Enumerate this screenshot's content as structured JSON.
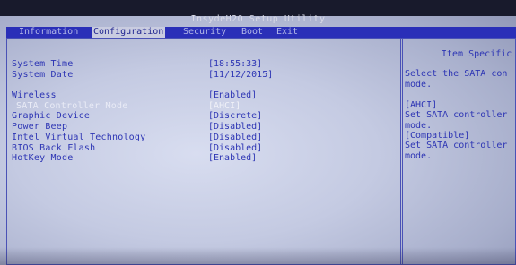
{
  "app": {
    "title": "InsydeH2O Setup Utility"
  },
  "menu": [
    {
      "label": "Information",
      "active": false
    },
    {
      "label": "Configuration",
      "active": true
    },
    {
      "label": "Security",
      "active": false
    },
    {
      "label": "Boot",
      "active": false
    },
    {
      "label": "Exit",
      "active": false
    }
  ],
  "settings": [
    {
      "label": "System Time",
      "value": "[18:55:33]",
      "selected": false
    },
    {
      "label": "System Date",
      "value": "[11/12/2015]",
      "selected": false
    },
    {
      "label": "Wireless",
      "value": "[Enabled]",
      "selected": false
    },
    {
      "label": "SATA Controller Mode",
      "value": "[AHCI]",
      "selected": true
    },
    {
      "label": "Graphic Device",
      "value": "[Discrete]",
      "selected": false
    },
    {
      "label": "Power Beep",
      "value": "[Disabled]",
      "selected": false
    },
    {
      "label": "Intel Virtual Technology",
      "value": "[Disabled]",
      "selected": false
    },
    {
      "label": "BIOS Back Flash",
      "value": "[Disabled]",
      "selected": false
    },
    {
      "label": "HotKey Mode",
      "value": "[Enabled]",
      "selected": false
    }
  ],
  "help": {
    "title": "Item Specific",
    "lines": [
      "Select the SATA con",
      "mode.",
      "",
      "[AHCI]",
      "Set SATA controller",
      "mode.",
      "[Compatible]",
      "Set SATA controller",
      "mode."
    ]
  },
  "colors": {
    "menubar_bg": "#2a2fb8",
    "text_blue": "#2d35b4",
    "highlight_text": "#f0f1f8",
    "panel_bg": "#c4cae2"
  }
}
